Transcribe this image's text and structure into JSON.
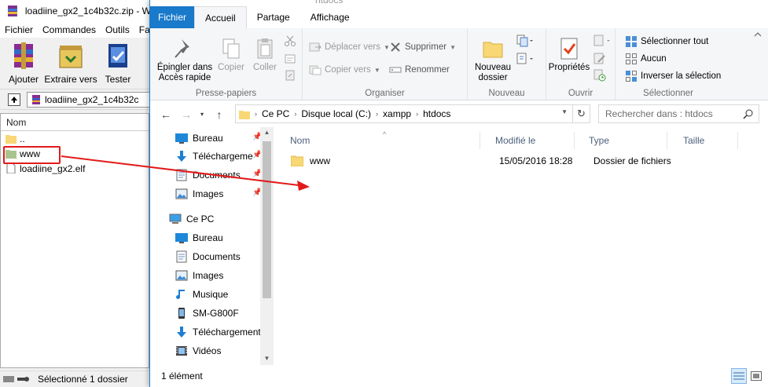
{
  "winrar": {
    "title": "loadiine_gx2_1c4b32c.zip - Win",
    "menu": [
      "Fichier",
      "Commandes",
      "Outils",
      "Fa"
    ],
    "toolbar": [
      {
        "label": "Ajouter",
        "icon": "winrar-add-icon"
      },
      {
        "label": "Extraire vers",
        "icon": "winrar-extract-icon"
      },
      {
        "label": "Tester",
        "icon": "winrar-test-icon"
      }
    ],
    "path": "loadiine_gx2_1c4b32c",
    "column_name": "Nom",
    "files": [
      {
        "name": "..",
        "icon": "folder-icon"
      },
      {
        "name": "www",
        "icon": "folder-icon"
      },
      {
        "name": "loadiine_gx2.elf",
        "icon": "file-icon"
      }
    ],
    "status": "Sélectionné 1 dossier"
  },
  "explorer": {
    "title_fragment": "htdocs",
    "tabs": [
      "Fichier",
      "Accueil",
      "Partage",
      "Affichage"
    ],
    "ribbon": {
      "clipboard": {
        "name": "Presse-papiers",
        "pin": "Épingler dans Accès rapide",
        "pin_l1": "Épingler dans",
        "pin_l2": "Accès rapide",
        "copy": "Copier",
        "paste": "Coller"
      },
      "organize": {
        "name": "Organiser",
        "move": "Déplacer vers",
        "copy_to": "Copier vers",
        "delete": "Supprimer",
        "rename": "Renommer"
      },
      "new": {
        "name": "Nouveau",
        "new_folder_l1": "Nouveau",
        "new_folder_l2": "dossier"
      },
      "open": {
        "name": "Ouvrir",
        "properties": "Propriétés"
      },
      "select": {
        "name": "Sélectionner",
        "all": "Sélectionner tout",
        "none": "Aucun",
        "invert": "Inverser la sélection"
      }
    },
    "address": {
      "crumbs": [
        "Ce PC",
        "Disque local (C:)",
        "xampp",
        "htdocs"
      ],
      "search_placeholder": "Rechercher dans : htdocs"
    },
    "nav": {
      "quick": [
        {
          "label": "Bureau",
          "icon": "desktop-icon"
        },
        {
          "label": "Téléchargeme",
          "icon": "download-icon"
        },
        {
          "label": "Documents",
          "icon": "documents-icon"
        },
        {
          "label": "Images",
          "icon": "images-icon"
        }
      ],
      "pc_label": "Ce PC",
      "pc": [
        {
          "label": "Bureau",
          "icon": "desktop-icon"
        },
        {
          "label": "Documents",
          "icon": "documents-icon"
        },
        {
          "label": "Images",
          "icon": "images-icon"
        },
        {
          "label": "Musique",
          "icon": "music-icon"
        },
        {
          "label": "SM-G800F",
          "icon": "phone-icon"
        },
        {
          "label": "Téléchargement",
          "icon": "download-icon"
        },
        {
          "label": "Vidéos",
          "icon": "videos-icon"
        }
      ]
    },
    "columns": [
      "Nom",
      "Modifié le",
      "Type",
      "Taille"
    ],
    "files": [
      {
        "name": "www",
        "modified": "15/05/2016 18:28",
        "type": "Dossier de fichiers",
        "size": ""
      }
    ],
    "status": "1 élément"
  },
  "colors": {
    "accent": "#1979ca",
    "highlight_red": "#e21a1a",
    "folder": "#f8d775"
  }
}
